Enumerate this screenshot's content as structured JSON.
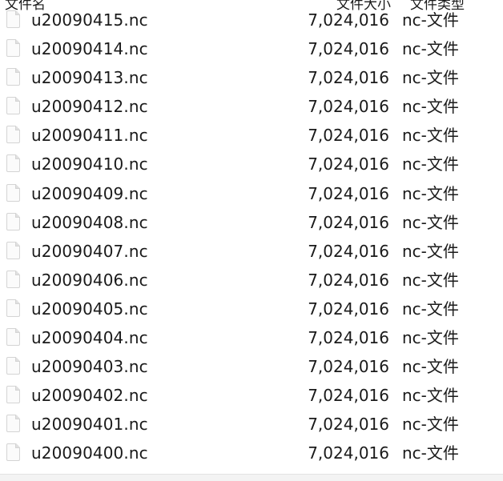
{
  "header": {
    "name_label": "文件名",
    "size_label": "文件大小",
    "kind_label": "文件类型"
  },
  "files": [
    {
      "name": "u20090415.nc",
      "size": "7,024,016",
      "kind": "nc-文件",
      "icon": "document-icon"
    },
    {
      "name": "u20090414.nc",
      "size": "7,024,016",
      "kind": "nc-文件",
      "icon": "document-icon"
    },
    {
      "name": "u20090413.nc",
      "size": "7,024,016",
      "kind": "nc-文件",
      "icon": "document-icon"
    },
    {
      "name": "u20090412.nc",
      "size": "7,024,016",
      "kind": "nc-文件",
      "icon": "document-icon"
    },
    {
      "name": "u20090411.nc",
      "size": "7,024,016",
      "kind": "nc-文件",
      "icon": "document-icon"
    },
    {
      "name": "u20090410.nc",
      "size": "7,024,016",
      "kind": "nc-文件",
      "icon": "document-icon"
    },
    {
      "name": "u20090409.nc",
      "size": "7,024,016",
      "kind": "nc-文件",
      "icon": "document-icon"
    },
    {
      "name": "u20090408.nc",
      "size": "7,024,016",
      "kind": "nc-文件",
      "icon": "document-icon"
    },
    {
      "name": "u20090407.nc",
      "size": "7,024,016",
      "kind": "nc-文件",
      "icon": "document-icon"
    },
    {
      "name": "u20090406.nc",
      "size": "7,024,016",
      "kind": "nc-文件",
      "icon": "document-icon"
    },
    {
      "name": "u20090405.nc",
      "size": "7,024,016",
      "kind": "nc-文件",
      "icon": "document-icon"
    },
    {
      "name": "u20090404.nc",
      "size": "7,024,016",
      "kind": "nc-文件",
      "icon": "document-icon"
    },
    {
      "name": "u20090403.nc",
      "size": "7,024,016",
      "kind": "nc-文件",
      "icon": "document-icon"
    },
    {
      "name": "u20090402.nc",
      "size": "7,024,016",
      "kind": "nc-文件",
      "icon": "document-icon"
    },
    {
      "name": "u20090401.nc",
      "size": "7,024,016",
      "kind": "nc-文件",
      "icon": "document-icon"
    },
    {
      "name": "u20090400.nc",
      "size": "7,024,016",
      "kind": "nc-文件",
      "icon": "document-icon"
    }
  ]
}
